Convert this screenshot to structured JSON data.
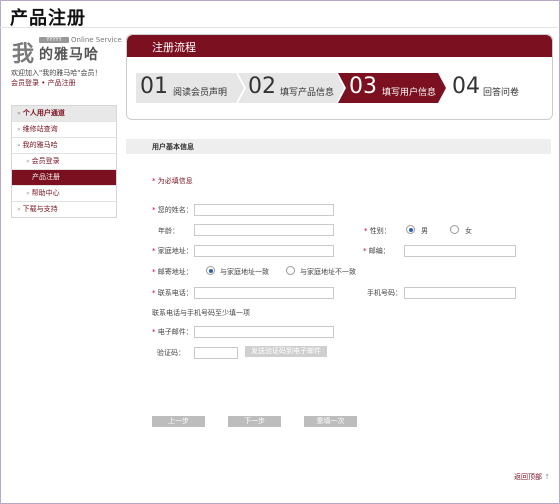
{
  "page": {
    "title": "产品注册"
  },
  "brand": {
    "logo_char": "我",
    "logo_text": "的雅马哈",
    "logo_english": "Online Service",
    "logo_badge": "YYYYY"
  },
  "welcome": {
    "line1": "欢迎加入\"我的雅马哈\"会员！",
    "login_link": "会员登录",
    "sep": " • ",
    "current": "产品注册"
  },
  "sidebar": {
    "items": [
      {
        "label": "个人用户通道"
      },
      {
        "label": "维修站查询"
      },
      {
        "label": "我的雅马哈"
      },
      {
        "label": "会员登录"
      },
      {
        "label": "产品注册"
      },
      {
        "label": "帮助中心"
      },
      {
        "label": "下载与支持"
      }
    ]
  },
  "process": {
    "title": "注册流程",
    "steps": [
      {
        "num": "01",
        "label": "阅读会员声明"
      },
      {
        "num": "02",
        "label": "填写产品信息"
      },
      {
        "num": "03",
        "label": "填写用户信息"
      },
      {
        "num": "04",
        "label": "回答问卷"
      }
    ]
  },
  "form": {
    "section_title": "用户基本信息",
    "required_note": "为必填信息",
    "fields": {
      "name": "您的姓名：",
      "age": "年龄：",
      "gender": "性别：",
      "gender_male": "男",
      "gender_female": "女",
      "home_address": "家庭地址：",
      "postcode": "邮编：",
      "mailing_address": "邮寄地址：",
      "same_as_home": "与家庭地址一致",
      "different_from_home": "与家庭地址不一致",
      "phone": "联系电话：",
      "mobile": "手机号码：",
      "phone_hint": "联系电话与手机号码至少填一项",
      "email": "电子邮件：",
      "captcha": "验证码：",
      "send_captcha": "发送验证码到电子邮件"
    },
    "buttons": {
      "prev": "上一步",
      "next": "下一步",
      "reset": "重填一次"
    }
  },
  "footer": {
    "back_to_top": "返回顶部"
  },
  "colors": {
    "accent": "#7a1020"
  }
}
